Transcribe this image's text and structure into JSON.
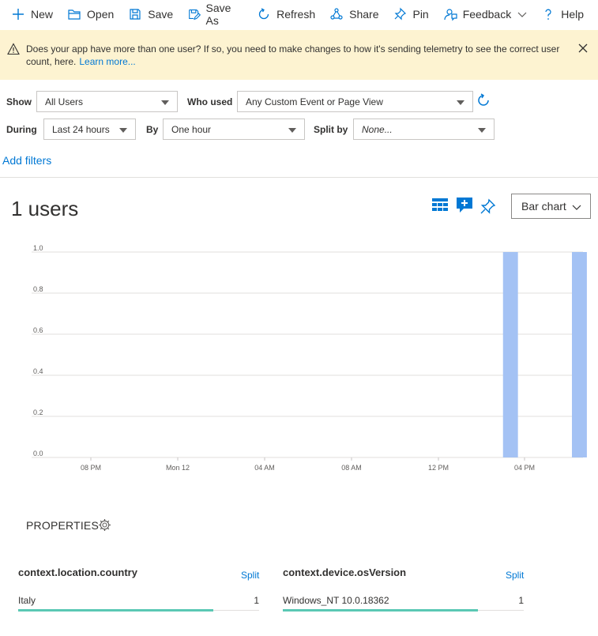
{
  "toolbar": {
    "new": "New",
    "open": "Open",
    "save": "Save",
    "save_as": "Save As",
    "refresh": "Refresh",
    "share": "Share",
    "pin": "Pin",
    "feedback": "Feedback",
    "help": "Help"
  },
  "banner": {
    "message": "Does your app have more than one user? If so, you need to make changes to how it's sending telemetry to see the correct user count, here.",
    "link": "Learn more..."
  },
  "filters": {
    "show_label": "Show",
    "show_value": "All Users",
    "who_used_label": "Who used",
    "who_used_value": "Any Custom Event or Page View",
    "during_label": "During",
    "during_value": "Last 24 hours",
    "by_label": "By",
    "by_value": "One hour",
    "split_by_label": "Split by",
    "split_by_value": "None...",
    "add_filters": "Add filters"
  },
  "summary": {
    "title": "1 users",
    "chart_type": "Bar chart"
  },
  "colors": {
    "bar": "#a4c2f4",
    "accent": "#0078d4",
    "prop_bar": "#5ac8b4"
  },
  "chart_data": {
    "type": "bar",
    "y_ticks": [
      "1.0",
      "0.8",
      "0.6",
      "0.4",
      "0.2",
      "0.0"
    ],
    "ylim": [
      0,
      1.0
    ],
    "x_tick_labels": [
      "08 PM",
      "Mon 12",
      "04 AM",
      "08 AM",
      "12 PM",
      "04 PM"
    ],
    "bins": 24,
    "values": [
      0,
      0,
      0,
      0,
      0,
      0,
      0,
      0,
      0,
      0,
      0,
      0,
      0,
      0,
      0,
      0,
      0,
      0,
      0,
      0,
      1,
      0,
      0,
      1
    ],
    "grid": true
  },
  "properties": {
    "title": "PROPERTIES",
    "columns": [
      {
        "header": "context.location.country",
        "split": "Split",
        "rows": [
          {
            "value": "Italy",
            "count": "1",
            "fraction": 1.0
          }
        ]
      },
      {
        "header": "context.device.osVersion",
        "split": "Split",
        "rows": [
          {
            "value": "Windows_NT 10.0.18362",
            "count": "1",
            "fraction": 1.0
          }
        ]
      }
    ]
  }
}
